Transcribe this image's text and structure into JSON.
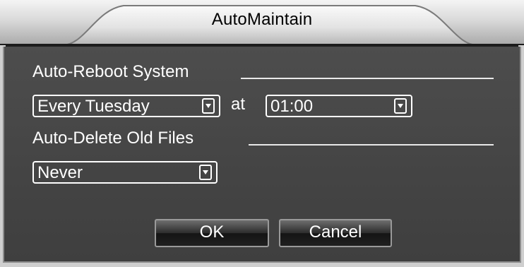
{
  "dialog": {
    "title": "AutoMaintain"
  },
  "reboot": {
    "section_label": "Auto-Reboot System",
    "schedule_value": "Every Tuesday",
    "at_label": "at",
    "time_value": "01:00"
  },
  "delete": {
    "section_label": "Auto-Delete Old Files",
    "value": "Never"
  },
  "buttons": {
    "ok_label": "OK",
    "cancel_label": "Cancel"
  },
  "icons": {
    "dropdown": "chevron-down-icon"
  }
}
